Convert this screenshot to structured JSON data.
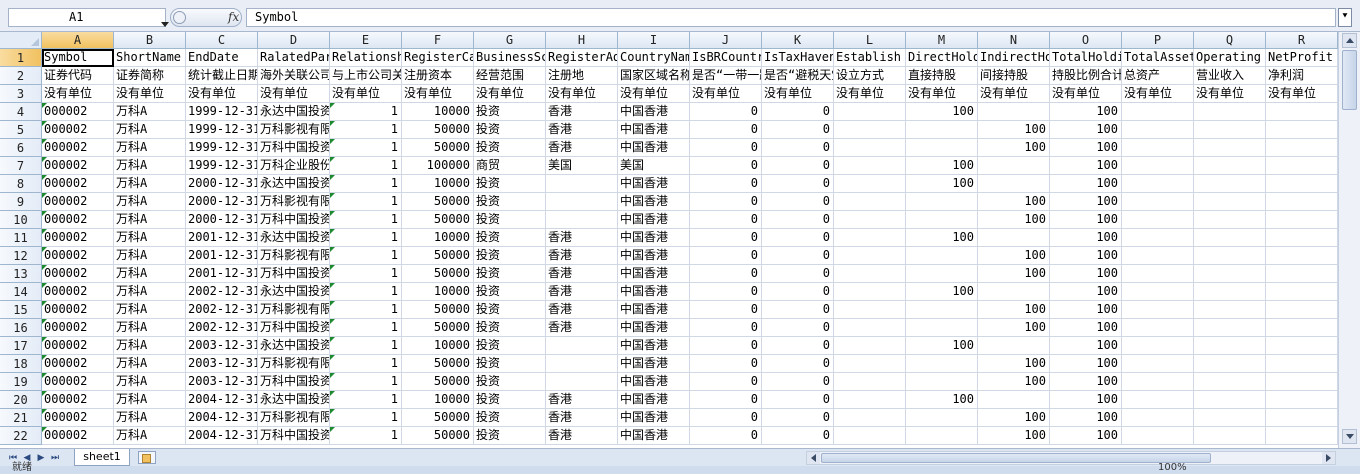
{
  "namebox": "A1",
  "fx_label": "fx",
  "formula": "Symbol",
  "sheet_tab": "sheet1",
  "status": "就绪",
  "zoom": "100%",
  "columns": [
    "A",
    "B",
    "C",
    "D",
    "E",
    "F",
    "G",
    "H",
    "I",
    "J",
    "K",
    "L",
    "M",
    "N",
    "O",
    "P",
    "Q",
    "R"
  ],
  "rows": [
    {
      "num": "1",
      "cells": [
        "Symbol",
        "ShortName",
        "EndDate",
        "RalatedParty",
        "Relationship",
        "RegisterCapital",
        "BusinessScope",
        "RegisterAddress",
        "CountryName",
        "IsBRCountry",
        "IsTaxHaven",
        "Establish",
        "DirectHolding",
        "IndirectHolding",
        "TotalHolding",
        "TotalAssets",
        "Operating",
        "NetProfit"
      ]
    },
    {
      "num": "2",
      "cells": [
        "证券代码",
        "证券简称",
        "统计截止日期",
        "海外关联公司",
        "与上市公司关系",
        "注册资本",
        "经营范围",
        "注册地",
        "国家区域名称",
        "是否“一带一路”",
        "是否“避税天堂”",
        "设立方式",
        "直接持股",
        "间接持股",
        "持股比例合计",
        "总资产",
        "营业收入",
        "净利润"
      ]
    },
    {
      "num": "3",
      "cells": [
        "没有单位",
        "没有单位",
        "没有单位",
        "没有单位",
        "没有单位",
        "没有单位",
        "没有单位",
        "没有单位",
        "没有单位",
        "没有单位",
        "没有单位",
        "没有单位",
        "没有单位",
        "没有单位",
        "没有单位",
        "没有单位",
        "没有单位",
        "没有单位"
      ]
    },
    {
      "num": "4",
      "cells": [
        "000002",
        "万科A",
        "1999-12-31",
        "永达中国投资",
        "1",
        "10000",
        "投资",
        "香港",
        "中国香港",
        "0",
        "0",
        "",
        "100",
        "",
        "100",
        "",
        "",
        ""
      ]
    },
    {
      "num": "5",
      "cells": [
        "000002",
        "万科A",
        "1999-12-31",
        "万科影视有限",
        "1",
        "50000",
        "投资",
        "香港",
        "中国香港",
        "0",
        "0",
        "",
        "",
        "100",
        "100",
        "",
        "",
        ""
      ]
    },
    {
      "num": "6",
      "cells": [
        "000002",
        "万科A",
        "1999-12-31",
        "万科中国投资",
        "1",
        "50000",
        "投资",
        "香港",
        "中国香港",
        "0",
        "0",
        "",
        "",
        "100",
        "100",
        "",
        "",
        ""
      ]
    },
    {
      "num": "7",
      "cells": [
        "000002",
        "万科A",
        "1999-12-31",
        "万科企业股份",
        "1",
        "100000",
        "商贸",
        "美国",
        "美国",
        "0",
        "0",
        "",
        "100",
        "",
        "100",
        "",
        "",
        ""
      ]
    },
    {
      "num": "8",
      "cells": [
        "000002",
        "万科A",
        "2000-12-31",
        "永达中国投资",
        "1",
        "10000",
        "投资",
        "",
        "中国香港",
        "0",
        "0",
        "",
        "100",
        "",
        "100",
        "",
        "",
        ""
      ]
    },
    {
      "num": "9",
      "cells": [
        "000002",
        "万科A",
        "2000-12-31",
        "万科影视有限",
        "1",
        "50000",
        "投资",
        "",
        "中国香港",
        "0",
        "0",
        "",
        "",
        "100",
        "100",
        "",
        "",
        ""
      ]
    },
    {
      "num": "10",
      "cells": [
        "000002",
        "万科A",
        "2000-12-31",
        "万科中国投资",
        "1",
        "50000",
        "投资",
        "",
        "中国香港",
        "0",
        "0",
        "",
        "",
        "100",
        "100",
        "",
        "",
        ""
      ]
    },
    {
      "num": "11",
      "cells": [
        "000002",
        "万科A",
        "2001-12-31",
        "永达中国投资",
        "1",
        "10000",
        "投资",
        "香港",
        "中国香港",
        "0",
        "0",
        "",
        "100",
        "",
        "100",
        "",
        "",
        ""
      ]
    },
    {
      "num": "12",
      "cells": [
        "000002",
        "万科A",
        "2001-12-31",
        "万科影视有限",
        "1",
        "50000",
        "投资",
        "香港",
        "中国香港",
        "0",
        "0",
        "",
        "",
        "100",
        "100",
        "",
        "",
        ""
      ]
    },
    {
      "num": "13",
      "cells": [
        "000002",
        "万科A",
        "2001-12-31",
        "万科中国投资",
        "1",
        "50000",
        "投资",
        "香港",
        "中国香港",
        "0",
        "0",
        "",
        "",
        "100",
        "100",
        "",
        "",
        ""
      ]
    },
    {
      "num": "14",
      "cells": [
        "000002",
        "万科A",
        "2002-12-31",
        "永达中国投资",
        "1",
        "10000",
        "投资",
        "香港",
        "中国香港",
        "0",
        "0",
        "",
        "100",
        "",
        "100",
        "",
        "",
        ""
      ]
    },
    {
      "num": "15",
      "cells": [
        "000002",
        "万科A",
        "2002-12-31",
        "万科影视有限",
        "1",
        "50000",
        "投资",
        "香港",
        "中国香港",
        "0",
        "0",
        "",
        "",
        "100",
        "100",
        "",
        "",
        ""
      ]
    },
    {
      "num": "16",
      "cells": [
        "000002",
        "万科A",
        "2002-12-31",
        "万科中国投资",
        "1",
        "50000",
        "投资",
        "香港",
        "中国香港",
        "0",
        "0",
        "",
        "",
        "100",
        "100",
        "",
        "",
        ""
      ]
    },
    {
      "num": "17",
      "cells": [
        "000002",
        "万科A",
        "2003-12-31",
        "永达中国投资",
        "1",
        "10000",
        "投资",
        "",
        "中国香港",
        "0",
        "0",
        "",
        "100",
        "",
        "100",
        "",
        "",
        ""
      ]
    },
    {
      "num": "18",
      "cells": [
        "000002",
        "万科A",
        "2003-12-31",
        "万科影视有限",
        "1",
        "50000",
        "投资",
        "",
        "中国香港",
        "0",
        "0",
        "",
        "",
        "100",
        "100",
        "",
        "",
        ""
      ]
    },
    {
      "num": "19",
      "cells": [
        "000002",
        "万科A",
        "2003-12-31",
        "万科中国投资",
        "1",
        "50000",
        "投资",
        "",
        "中国香港",
        "0",
        "0",
        "",
        "",
        "100",
        "100",
        "",
        "",
        ""
      ]
    },
    {
      "num": "20",
      "cells": [
        "000002",
        "万科A",
        "2004-12-31",
        "永达中国投资",
        "1",
        "10000",
        "投资",
        "香港",
        "中国香港",
        "0",
        "0",
        "",
        "100",
        "",
        "100",
        "",
        "",
        ""
      ]
    },
    {
      "num": "21",
      "cells": [
        "000002",
        "万科A",
        "2004-12-31",
        "万科影视有限",
        "1",
        "50000",
        "投资",
        "香港",
        "中国香港",
        "0",
        "0",
        "",
        "",
        "100",
        "100",
        "",
        "",
        ""
      ]
    },
    {
      "num": "22",
      "cells": [
        "000002",
        "万科A",
        "2004-12-31",
        "万科中国投资",
        "1",
        "50000",
        "投资",
        "香港",
        "中国香港",
        "0",
        "0",
        "",
        "",
        "100",
        "100",
        "",
        "",
        ""
      ]
    }
  ],
  "numeric_columns": [
    4,
    5,
    9,
    10,
    12,
    13,
    14
  ],
  "green_triangle_columns": [
    0,
    4
  ]
}
